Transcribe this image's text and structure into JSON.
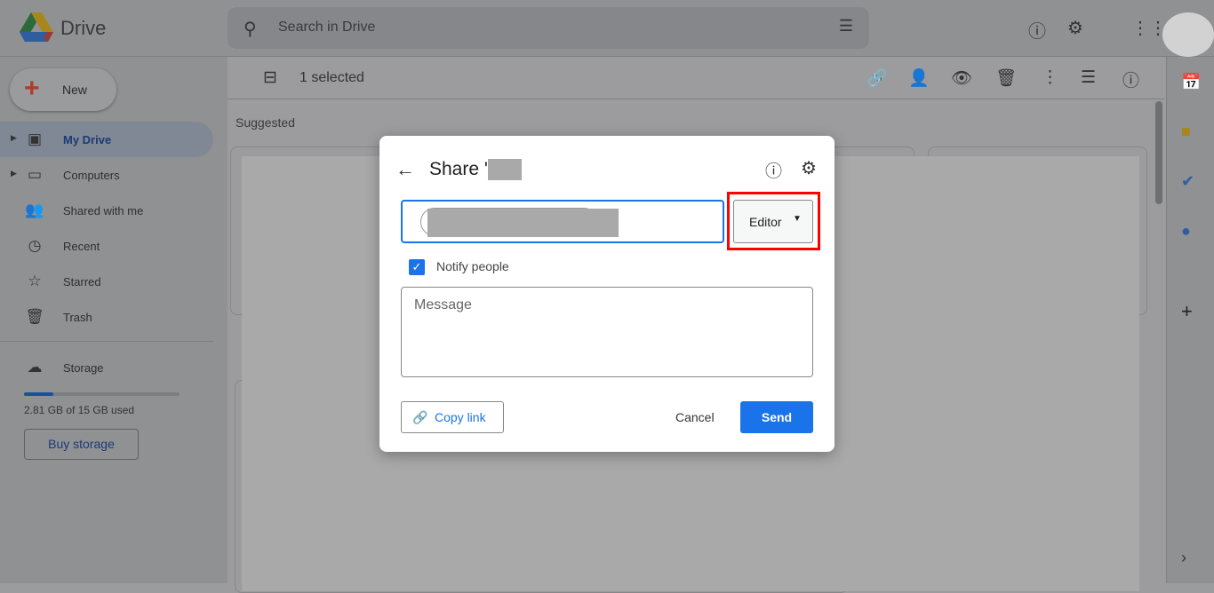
{
  "app": {
    "name": "Drive"
  },
  "header": {
    "search_placeholder": "Search in Drive"
  },
  "sidebar": {
    "new_label": "New",
    "items": [
      {
        "label": "My Drive",
        "icon": "my-drive-icon",
        "active": true
      },
      {
        "label": "Computers",
        "icon": "computers-icon"
      },
      {
        "label": "Shared with me",
        "icon": "shared-icon"
      },
      {
        "label": "Recent",
        "icon": "clock-icon"
      },
      {
        "label": "Starred",
        "icon": "star-icon"
      },
      {
        "label": "Trash",
        "icon": "trash-icon"
      }
    ],
    "storage_label": "Storage",
    "storage_used": "2.81 GB of 15 GB used",
    "storage_fraction": 0.19,
    "buy_storage": "Buy storage"
  },
  "toolbar": {
    "selected": "1 selected"
  },
  "main": {
    "section": "Suggested"
  },
  "dialog": {
    "title": "Share '",
    "role": "Editor",
    "notify_label": "Notify people",
    "notify_checked": true,
    "message_placeholder": "Message",
    "copy_link": "Copy link",
    "cancel": "Cancel",
    "send": "Send"
  },
  "colors": {
    "accent": "#1a73e8",
    "highlight": "#ff0000"
  }
}
